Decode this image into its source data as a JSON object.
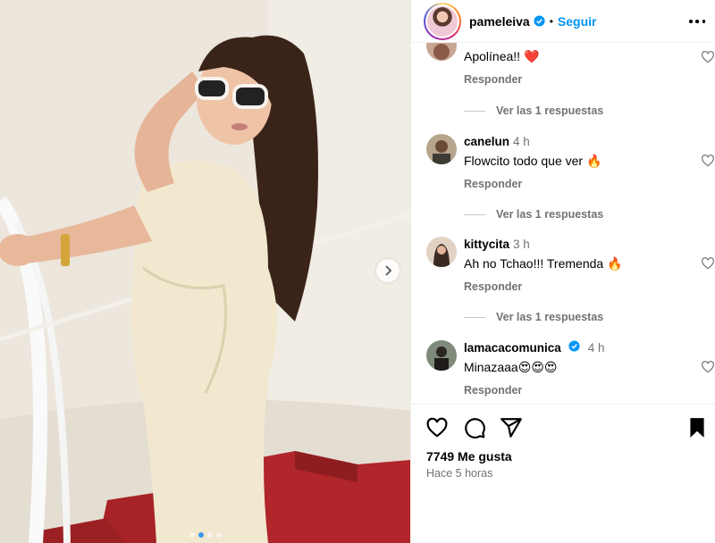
{
  "post": {
    "slide_index": 2,
    "slide_count": 4
  },
  "header": {
    "username": "pameleiva",
    "separator": "•",
    "follow_label": "Seguir"
  },
  "comments": [
    {
      "username": "",
      "time": "",
      "text": "Apolínea!! ❤️",
      "reply_label": "Responder",
      "view_replies": "Ver las 1 respuestas"
    },
    {
      "username": "canelun",
      "time": "4 h",
      "text": "Flowcito todo que ver 🔥",
      "reply_label": "Responder",
      "view_replies": "Ver las 1 respuestas"
    },
    {
      "username": "kittycita",
      "time": "3 h",
      "text": "Ah no Tchao!!! Tremenda 🔥",
      "reply_label": "Responder",
      "view_replies": "Ver las 1 respuestas"
    },
    {
      "username": "lamacacomunica",
      "time": "4 h",
      "text": "Minazaaa😍😍😍",
      "reply_label": "Responder",
      "verified": true
    }
  ],
  "footer": {
    "likes": "7749 Me gusta",
    "time_ago": "Hace 5 horas"
  },
  "colors": {
    "accent": "#0095f6",
    "verified": "#0095f6",
    "muted": "#737373",
    "carousel_active_dot": "#3897f0"
  },
  "icons": {
    "like": "heart-icon",
    "comment": "comment-icon",
    "share": "paper-plane-icon",
    "save": "bookmark-icon",
    "next": "chevron-right-icon",
    "more": "more-options-icon",
    "verified": "verified-badge-icon"
  }
}
